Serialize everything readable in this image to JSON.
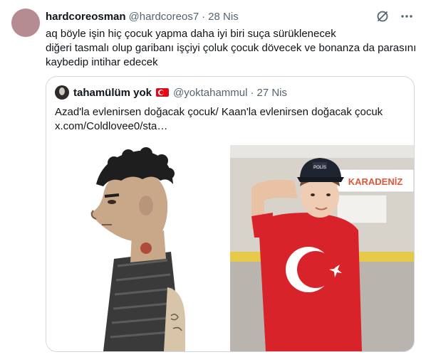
{
  "tweet": {
    "author_name": "hardcoreosman",
    "author_handle": "@hardcoreos7",
    "separator": "·",
    "date": "28 Nis",
    "text_lines": [
      "aq böyle işin hiç çocuk yapma daha iyi biri suça sürüklenecek",
      "diğeri tasmalı olup garibanı işçiyi çoluk çocuk dövecek ve bonanza da parasını",
      "kaybedip intihar edecek"
    ]
  },
  "quote": {
    "author_name": "tahamülüm yok",
    "author_handle": "@yoktahammul",
    "separator": "·",
    "date": "27 Nis",
    "text_line1": "Azad'la evlenirsen doğacak çocuk/ Kaan'la evlenirsen doğacak çocuk",
    "text_line2": "x.com/Coldlovee0/sta…",
    "media_right_sign": "KARADENİZ",
    "cap_text": "POLİS"
  },
  "icons": [
    "grok-icon",
    "more-icon"
  ],
  "colors": {
    "text": "#0f1419",
    "secondary": "#536471",
    "border": "#cfd9de",
    "flag_red": "#e30a17"
  }
}
